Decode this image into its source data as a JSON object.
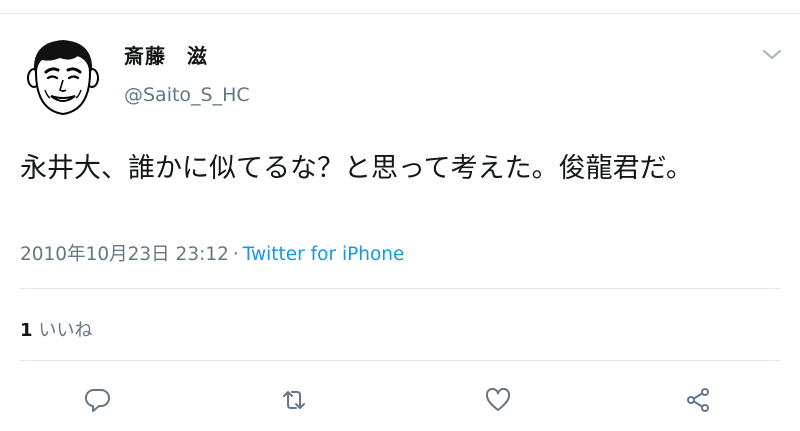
{
  "tweet": {
    "display_name": "斎藤　滋",
    "handle": "@Saito_S_HC",
    "text": "永井大、誰かに似てるな？と思って考えた。俊龍君だ。",
    "timestamp": "2010年10月23日 23:12",
    "separator": "·",
    "source": "Twitter for iPhone"
  },
  "stats": {
    "like_count": "1",
    "like_label": "いいね"
  },
  "icons": {
    "caret": "chevron-down-icon",
    "reply": "reply-icon",
    "retweet": "retweet-icon",
    "like": "heart-icon",
    "share": "share-icon"
  },
  "colors": {
    "text": "#14171a",
    "secondary": "#657786",
    "link": "#1b95e0",
    "divider": "#e1e8ed"
  }
}
